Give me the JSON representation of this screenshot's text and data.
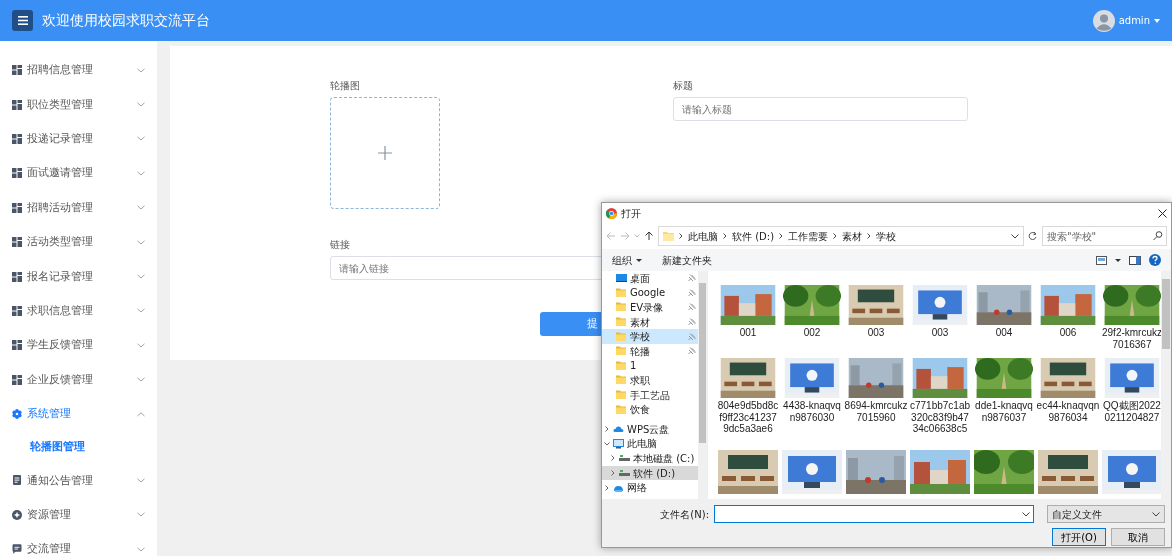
{
  "header": {
    "title": "欢迎使用校园求职交流平台",
    "user": "admin"
  },
  "sidebar": {
    "items": [
      {
        "label": "招聘信息管理",
        "kind": "grid",
        "expanded": false
      },
      {
        "label": "职位类型管理",
        "kind": "grid",
        "expanded": false
      },
      {
        "label": "投递记录管理",
        "kind": "grid",
        "expanded": false
      },
      {
        "label": "面试邀请管理",
        "kind": "grid",
        "expanded": false
      },
      {
        "label": "招聘活动管理",
        "kind": "grid",
        "expanded": false
      },
      {
        "label": "活动类型管理",
        "kind": "grid",
        "expanded": false
      },
      {
        "label": "报名记录管理",
        "kind": "grid",
        "expanded": false
      },
      {
        "label": "求职信息管理",
        "kind": "grid",
        "expanded": false
      },
      {
        "label": "学生反馈管理",
        "kind": "grid",
        "expanded": false
      },
      {
        "label": "企业反馈管理",
        "kind": "grid",
        "expanded": false
      },
      {
        "label": "系统管理",
        "kind": "gear",
        "expanded": true,
        "children": [
          {
            "label": "轮播图管理",
            "selected": true
          }
        ]
      },
      {
        "label": "通知公告管理",
        "kind": "document",
        "expanded": false
      },
      {
        "label": "资源管理",
        "kind": "star-circle",
        "expanded": false
      },
      {
        "label": "交流管理",
        "kind": "chat",
        "expanded": false
      }
    ]
  },
  "form": {
    "fields": [
      {
        "kind": "upload",
        "label": "轮播图"
      },
      {
        "kind": "text",
        "label": "标题",
        "placeholder": "请输入标题"
      },
      {
        "kind": "text",
        "label": "链接",
        "placeholder": "请输入链接"
      }
    ],
    "submit": "提"
  },
  "dialog": {
    "title": "打开",
    "address": {
      "back_enabled": false,
      "forward_enabled": false,
      "path": [
        "此电脑",
        "软件 (D:)",
        "工作需要",
        "素材",
        "学校"
      ],
      "search_placeholder": "搜索\"学校\""
    },
    "toolbar": {
      "organize": "组织",
      "new_folder": "新建文件夹"
    },
    "nav_pane": {
      "quick_access": [
        {
          "label": "桌面",
          "kind": "desktop",
          "pinned": true,
          "selected": false
        },
        {
          "label": "Google",
          "kind": "folder",
          "pinned": true,
          "selected": false
        },
        {
          "label": "EV录像",
          "kind": "folder",
          "pinned": true,
          "selected": false
        },
        {
          "label": "素材",
          "kind": "folder",
          "pinned": true,
          "selected": false
        },
        {
          "label": "学校",
          "kind": "folder",
          "pinned": true,
          "selected": true
        },
        {
          "label": "轮播",
          "kind": "folder",
          "pinned": true,
          "selected": false
        },
        {
          "label": "1",
          "kind": "folder",
          "pinned": false,
          "selected": false
        },
        {
          "label": "求职",
          "kind": "folder",
          "pinned": false,
          "selected": false
        },
        {
          "label": "手工艺品",
          "kind": "folder",
          "pinned": false,
          "selected": false
        },
        {
          "label": "饮食",
          "kind": "folder",
          "pinned": false,
          "selected": false
        }
      ],
      "tree": [
        {
          "label": "WPS云盘",
          "kind": "cloud",
          "expanded": false,
          "selected": false
        },
        {
          "label": "此电脑",
          "kind": "computer",
          "expanded": true,
          "selected": false,
          "children": [
            {
              "label": "本地磁盘 (C:)",
              "kind": "drive",
              "expanded": false,
              "selected": false
            },
            {
              "label": "软件 (D:)",
              "kind": "drive",
              "expanded": false,
              "selected": true
            }
          ]
        },
        {
          "label": "网络",
          "kind": "network",
          "expanded": false,
          "selected": false
        }
      ]
    },
    "files": [
      {
        "name": "001"
      },
      {
        "name": "002"
      },
      {
        "name": "003"
      },
      {
        "name": "003"
      },
      {
        "name": "004"
      },
      {
        "name": "006"
      },
      {
        "name": "29f2-kmrcukz7016367"
      },
      {
        "name": "804e9d5bd8cf9ff23c412379dc5a3ae6"
      },
      {
        "name": "4438-knaqvqn9876030"
      },
      {
        "name": "8694-kmrcukz7015960"
      },
      {
        "name": "c771bb7c1ab320c83f9b4734c06638c5"
      },
      {
        "name": "dde1-knaqvqn9876037"
      },
      {
        "name": "ec44-knaqvqn9876034"
      },
      {
        "name": "QQ截图20220211204827"
      }
    ],
    "more_thumbnails": [
      {
        "kind": "picture"
      },
      {
        "kind": "picture"
      },
      {
        "kind": "picture"
      },
      {
        "kind": "picture"
      },
      {
        "kind": "picture"
      },
      {
        "kind": "picture"
      },
      {
        "kind": "picture"
      }
    ],
    "file_name_label": "文件名(N):",
    "file_type": "自定义文件",
    "buttons": [
      "打开(O)",
      "取消"
    ]
  }
}
